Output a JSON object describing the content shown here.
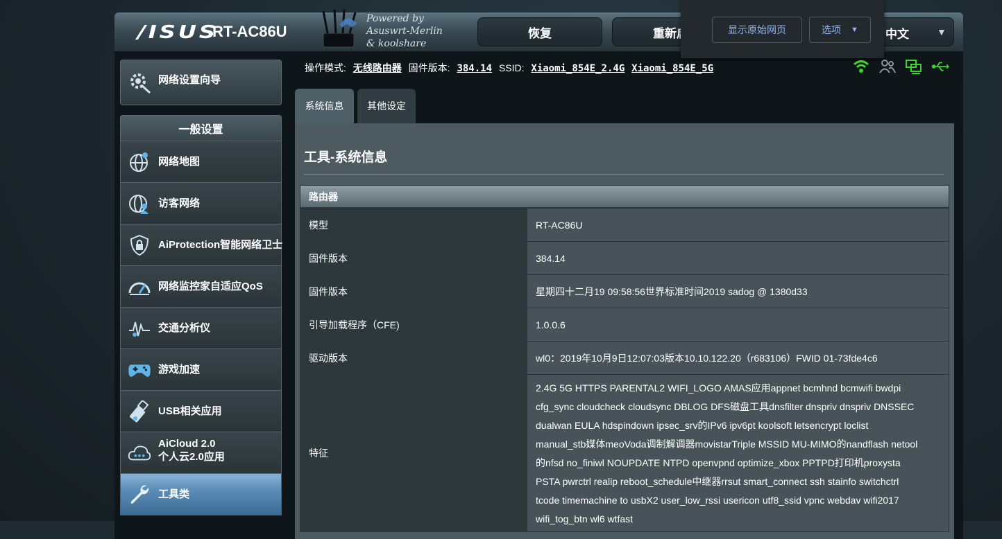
{
  "header": {
    "logo": "/ISUS",
    "model": "RT-AC86U",
    "powered_lines": [
      "Powered by",
      "Asuswrt-Merlin",
      "& koolshare"
    ],
    "buttons": [
      "恢复",
      "重新启"
    ],
    "language": "中文"
  },
  "translate_bar": {
    "show_original": "显示原始网页",
    "options": "选项"
  },
  "status": {
    "mode_label": "操作模式:",
    "mode_value": "无线路由器",
    "fw_label": "固件版本:",
    "fw_value": "384.14",
    "ssid_label": "SSID:",
    "ssid_24": "Xiaomi_854E_2.4G",
    "ssid_5": "Xiaomi_854E_5G",
    "icons": [
      "wifi-icon",
      "clients-icon",
      "network-icon",
      "usb-icon"
    ],
    "accent": "#3cd42e"
  },
  "sidebar": {
    "wizard": "网络设置向导",
    "section": "一般设置",
    "items": [
      {
        "label": "网络地图",
        "icon": "globe-map-icon"
      },
      {
        "label": "访客网络",
        "icon": "guest-network-icon"
      },
      {
        "label": "AiProtection智能网络卫士",
        "icon": "shield-lock-icon"
      },
      {
        "label": "网络监控家自适应QoS",
        "icon": "gauge-icon"
      },
      {
        "label": "交通分析仪",
        "icon": "traffic-analyzer-icon"
      },
      {
        "label": "游戏加速",
        "icon": "gamepad-icon"
      },
      {
        "label": "USB相关应用",
        "icon": "usb-app-icon"
      },
      {
        "label": "AiCloud 2.0",
        "label2": "个人云2.0应用",
        "icon": "cloud-icon"
      },
      {
        "label": "工具类",
        "icon": "wrench-icon"
      }
    ]
  },
  "tabs": [
    "系统信息",
    "其他设定"
  ],
  "main": {
    "title": "工具-系统信息",
    "table_header": "路由器",
    "rows": [
      {
        "key": "模型",
        "value": "RT-AC86U"
      },
      {
        "key": "固件版本",
        "value": "384.14"
      },
      {
        "key": "固件版本",
        "value": "星期四十二月19 09:58:56世界标准时间2019 sadog @ 1380d33"
      },
      {
        "key": "引导加载程序（CFE)",
        "value": "1.0.0.6"
      },
      {
        "key": "驱动版本",
        "value": "wl0：2019年10月9日12:07:03版本10.10.122.20（r683106）FWID 01-73fde4c6"
      }
    ],
    "features_key": "特征",
    "features_lines": [
      "2.4G 5G HTTPS PARENTAL2 WIFI_LOGO AMAS应用appnet bcmhnd bcmwifi bwdpi",
      "cfg_sync cloudcheck cloudsync DBLOG DFS磁盘工具dnsfilter dnspriv dnspriv DNSSEC",
      "dualwan EULA hdspindown ipsec_srv的IPv6 ipv6pt koolsoft letsencrypt loclist",
      "manual_stb媒体meoVoda调制解调器movistarTriple MSSID MU-MIMO的nandflash netool",
      "的nfsd no_finiwl NOUPDATE NTPD openvpnd optimize_xbox PPTPD打印机proxysta",
      "PSTA pwrctrl realip reboot_schedule中继器rrsut smart_connect ssh stainfo switchctrl",
      "tcode timemachine to usbX2 user_low_rssi usericon utf8_ssid vpnc webdav wifi2017",
      "wifi_tog_btn wl6 wtfast"
    ]
  }
}
